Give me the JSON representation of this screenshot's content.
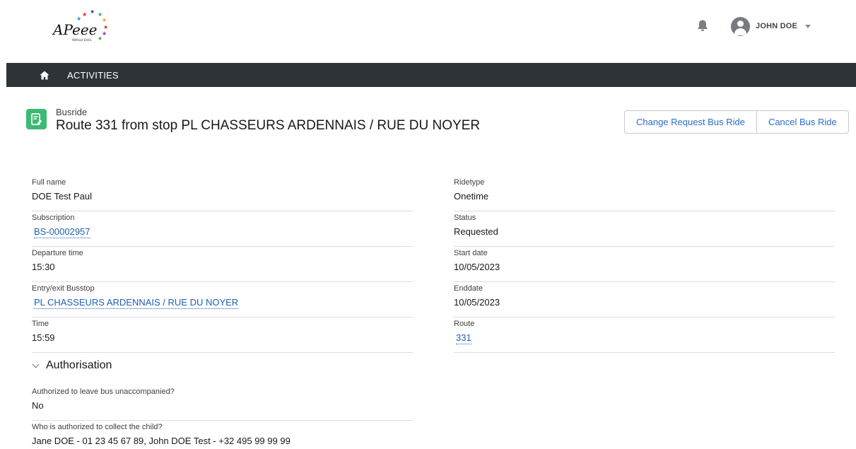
{
  "header": {
    "logo_text": "APeee",
    "logo_subtext": "Without Extra",
    "user_name": "JOHN DOE"
  },
  "nav": {
    "activities_label": "ACTIVITIES"
  },
  "record": {
    "type": "Busride",
    "title": "Route 331 from stop PL CHASSEURS ARDENNAIS / RUE DU NOYER",
    "icon_color": "#3bba72"
  },
  "actions": {
    "change_request_label": "Change Request Bus Ride",
    "cancel_label": "Cancel Bus Ride"
  },
  "fields_left": [
    {
      "label": "Full name",
      "value": "DOE Test Paul"
    },
    {
      "label": "Subscription",
      "value": "BS-00002957"
    },
    {
      "label": "Departure time",
      "value": "15:30"
    },
    {
      "label": "Entry/exit Busstop",
      "value": "PL CHASSEURS ARDENNAIS / RUE DU NOYER"
    },
    {
      "label": "Time",
      "value": "15:59"
    }
  ],
  "fields_right": [
    {
      "label": "Ridetype",
      "value": "Onetime"
    },
    {
      "label": "Status",
      "value": "Requested"
    },
    {
      "label": "Start date",
      "value": "10/05/2023"
    },
    {
      "label": "Enddate",
      "value": "10/05/2023"
    },
    {
      "label": "Route",
      "value": "331"
    }
  ],
  "authorisation": {
    "section_title": "Authorisation",
    "fields": [
      {
        "label": "Authorized to leave bus unaccompanied?",
        "value": "No"
      },
      {
        "label": "Who is authorized to collect the child?",
        "value": "Jane DOE - 01 23 45 67 89, John DOE Test - +32 495 99 99 99"
      }
    ]
  },
  "colors": {
    "navbar": "#2e3338",
    "link": "#1f5fb3",
    "button_text": "#2a6dcc"
  }
}
